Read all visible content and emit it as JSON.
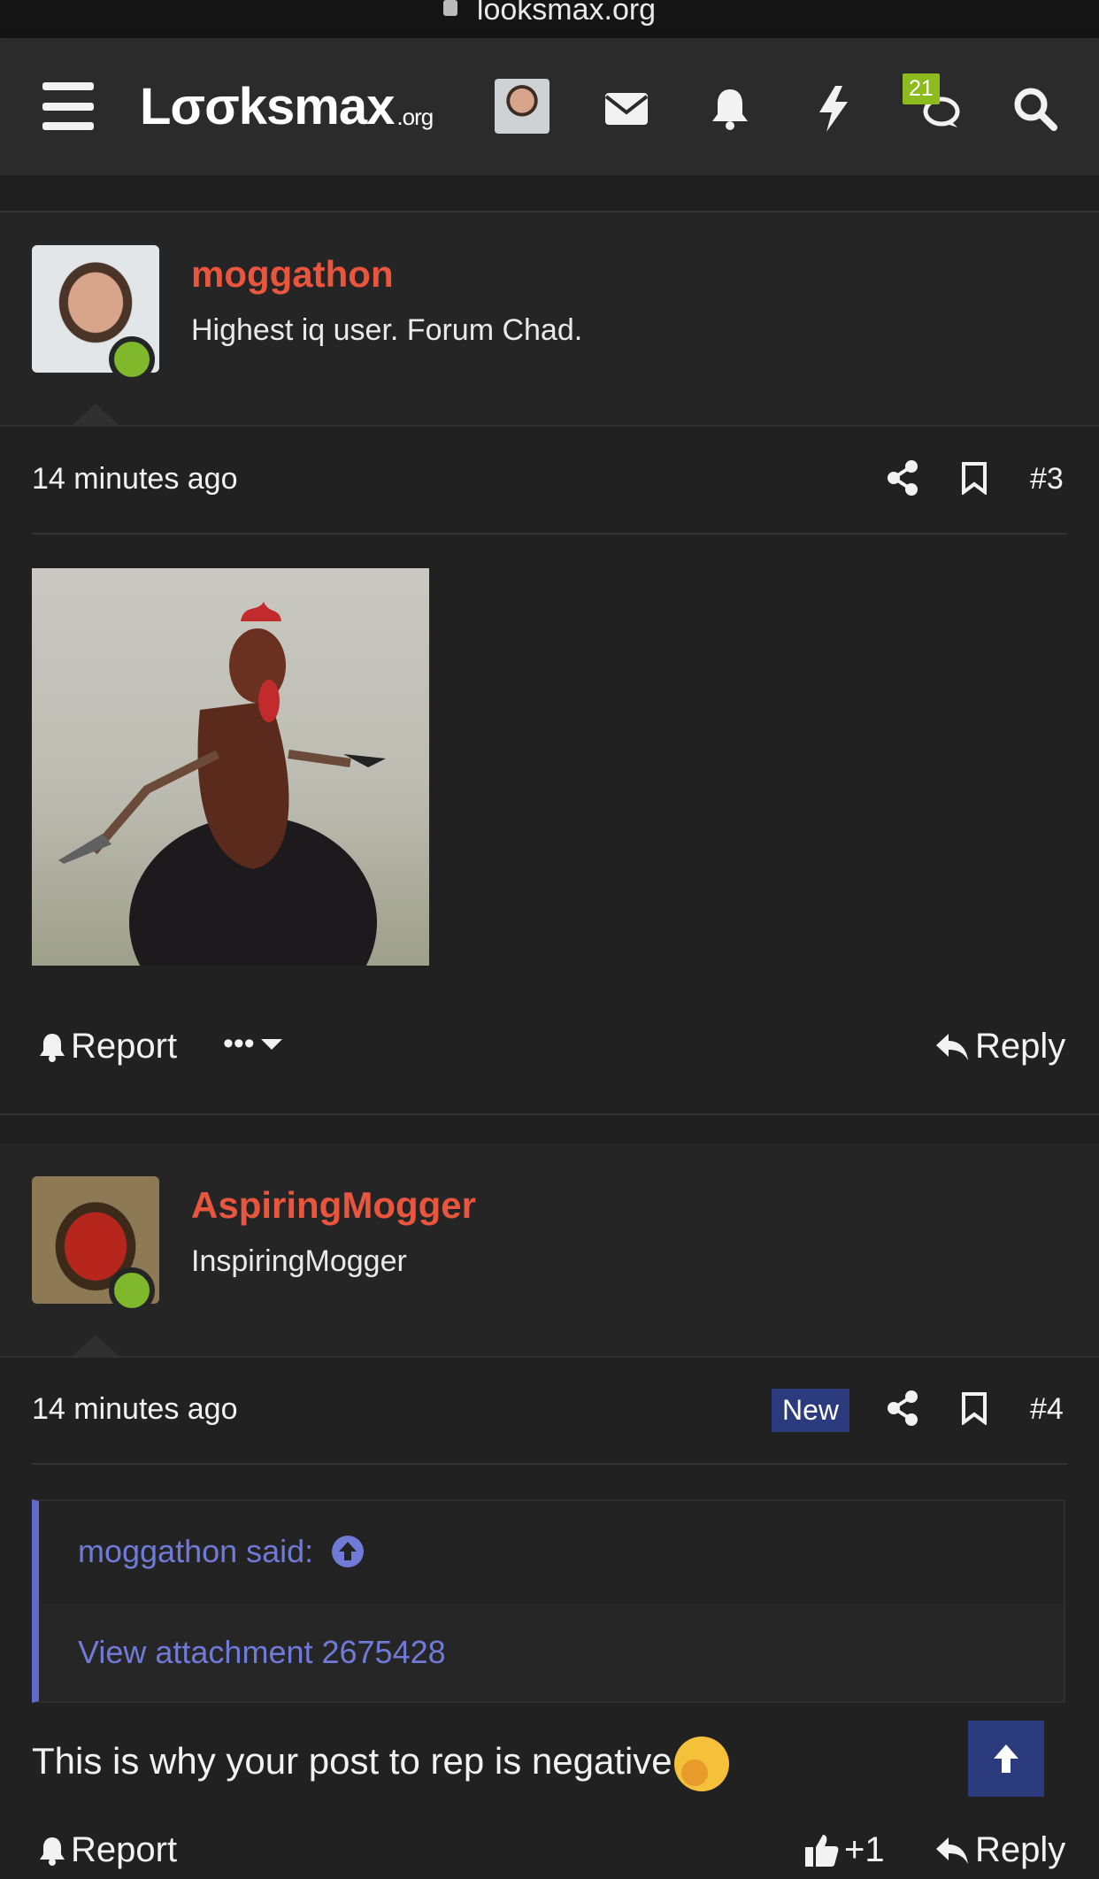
{
  "browser": {
    "url": "looksmax.org"
  },
  "header": {
    "logo_main": "Lσσksmax",
    "logo_suffix": ".org",
    "notification_count": "21"
  },
  "posts": [
    {
      "username": "moggathon",
      "user_title": "Highest iq user. Forum Chad.",
      "time": "14 minutes ago",
      "number": "#3",
      "attachment": "rooster-with-knife-image",
      "report_label": "Report",
      "more_label": "•••",
      "reply_label": "Reply"
    },
    {
      "username": "AspiringMogger",
      "user_title": "InspiringMogger",
      "time": "14 minutes ago",
      "new_label": "New",
      "number": "#4",
      "quote_author": "moggathon said:",
      "quote_body": "View attachment 2675428",
      "text": "This is why your post to rep is negative",
      "report_label": "Report",
      "like_count": "+1",
      "reply_label": "Reply"
    }
  ],
  "colors": {
    "background": "#212121",
    "username": "#e9553d",
    "online": "#7fb82a",
    "quote_accent": "#5f6bc8",
    "new_badge": "#2c3b7e"
  },
  "icons": [
    "menu-icon",
    "mail-icon",
    "bell-icon",
    "lightning-icon",
    "chat-icon",
    "search-icon",
    "share-icon",
    "bookmark-icon",
    "thumbs-up-icon",
    "reply-icon",
    "arrow-up-icon"
  ]
}
